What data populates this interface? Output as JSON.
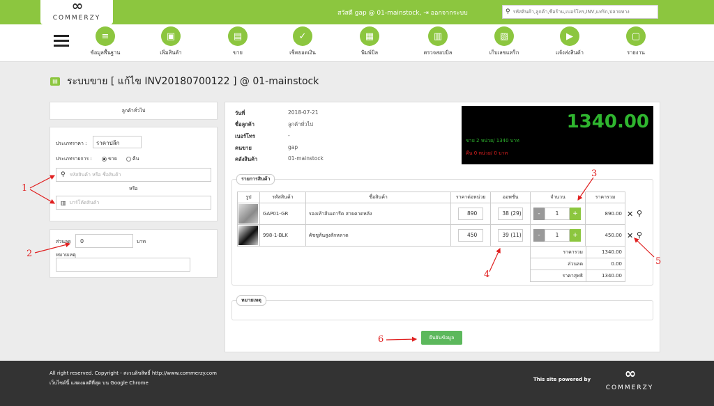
{
  "header": {
    "logo_mark": "∞",
    "logo_text": "COMMERZY",
    "greeting": "สวัสดี gap @ 01-mainstock,",
    "logout": "ออกจากระบบ",
    "search_placeholder": "รหัสสินค้า,ลูกค้า,ชื่อร้าน,เบอร์โทร,INV,แทร็ก,ปลายทาง"
  },
  "nav": [
    {
      "label": "ข้อมูลพื้นฐาน",
      "icon": "database-icon"
    },
    {
      "label": "เพิ่มสินค้า",
      "icon": "box-icon"
    },
    {
      "label": "ขาย",
      "icon": "cash-register-icon"
    },
    {
      "label": "เช็คยอดเงิน",
      "icon": "check-money-icon"
    },
    {
      "label": "พิมพ์บิล",
      "icon": "printer-icon"
    },
    {
      "label": "ตรวจสอบบิล",
      "icon": "bill-check-icon"
    },
    {
      "label": "เก็บเลขแทร็ก",
      "icon": "tracking-icon"
    },
    {
      "label": "แจ้งส่งสินค้า",
      "icon": "truck-icon"
    },
    {
      "label": "รายงาน",
      "icon": "report-icon"
    }
  ],
  "page_title": "ระบบขาย [ แก้ไข INV20180700122 ] @ 01-mainstock",
  "left": {
    "customer_type": "ลูกค้าทั่วไป",
    "price_type_label": "ประเภทราคา :",
    "price_type_value": "ราคาปลีก",
    "list_type_label": "ประเภทรายการ :",
    "radio_sell": "ขาย",
    "radio_return": "คืน",
    "search_placeholder": "รหัสสินค้า หรือ ชื่อสินค้า",
    "or_label": "หรือ",
    "barcode_placeholder": "บาร์โค้ดสินค้า",
    "discount_label": "ส่วนลด",
    "discount_value": "0",
    "discount_unit": "บาท",
    "note_label": "หมายเหตุ"
  },
  "info": {
    "date_label": "วันที่",
    "date_value": "2018-07-21",
    "customer_label": "ชื่อลูกค้า",
    "customer_value": "ลูกค้าทั่วไป",
    "phone_label": "เบอร์โทร",
    "phone_value": "-",
    "seller_label": "คนขาย",
    "seller_value": "gap",
    "warehouse_label": "คลังสินค้า",
    "warehouse_value": "01-mainstock"
  },
  "display": {
    "total": "1340.00",
    "sell_summary": "ขาย 2 หน่วย/ 1340 บาท",
    "return_summary": "คืน 0 หน่วย/ 0 บาท"
  },
  "items_legend": "รายการสินค้า",
  "columns": [
    "รูป",
    "รหัสสินค้า",
    "ชื่อสินค้า",
    "ราคาต่อหน่วย",
    "ออพชั่น",
    "จำนวน",
    "ราคารวม"
  ],
  "items": [
    {
      "sku": "GAP01-GR",
      "name": "รองเท้าส้นเตารีด สายคาดหลัง",
      "price": "890",
      "option": "38 (29)",
      "qty": "1",
      "total": "890.00"
    },
    {
      "sku": "998-1-BLK",
      "name": "คัชชูส้นสูงสักหลาด",
      "price": "450",
      "option": "39 (11)",
      "qty": "1",
      "total": "450.00"
    }
  ],
  "summary": [
    {
      "label": "ราคารวม",
      "value": "1340.00"
    },
    {
      "label": "ส่วนลด",
      "value": "0.00"
    },
    {
      "label": "ราคาสุทธิ",
      "value": "1340.00"
    }
  ],
  "note_legend": "หมายเหตุ",
  "confirm_label": "ยืนยันข้อมูล",
  "annotations": [
    "1",
    "2",
    "3",
    "4",
    "5",
    "6"
  ],
  "footer": {
    "line1": "All right reserved. Copyright - สงวนลิขสิทธิ์ http://www.commerzy.com",
    "line2": "เว็บไซต์นี้ แสดงผลดีที่สุด บน Google Chrome",
    "powered": "This site powered by",
    "logo_mark": "∞",
    "logo_text": "COMMERZY"
  },
  "colors": {
    "accent": "#8cc63f",
    "display_green": "#2fb52f",
    "display_red": "#e02020",
    "annotation": "#e02020"
  }
}
